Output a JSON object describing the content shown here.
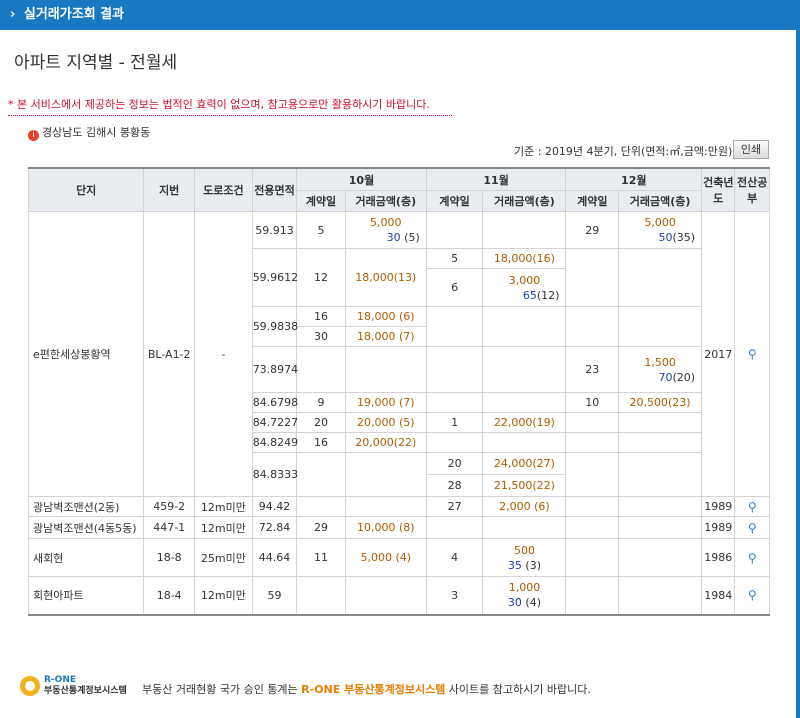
{
  "header": {
    "arrow": "›",
    "title": "실거래가조회 결과"
  },
  "page_title": "아파트 지역별 - 전월세",
  "notice": "* 본 서비스에서 제공하는 정보는 법적인 효력이 없으며, 참고용으로만 활용하시기 바랍니다.",
  "region": {
    "icon": "i",
    "label": "경상남도 김해시 봉황동"
  },
  "basis": "기준 : 2019년 4분기, 단위(면적:㎡,금액:만원)",
  "print_label": "인쇄",
  "columns": {
    "complex": "단지",
    "lot": "지번",
    "road": "도로조건",
    "area": "전용면적",
    "m10": "10월",
    "m11": "11월",
    "m12": "12월",
    "contract_day": "계약일",
    "amount": "거래금액(층)",
    "built": "건축년도",
    "cadastre": "전산공부"
  },
  "complexes": [
    {
      "name": "e편한세상봉황역",
      "lot": "BL-A1-2",
      "road": "-",
      "built": "2017",
      "rows": [
        {
          "area": "59.913",
          "m10_day": "5",
          "m10_amt": "5,000",
          "m10_rent": "30",
          "m10_floor": "(5)",
          "m12_day": "29",
          "m12_amt": "5,000",
          "m12_rent": "50",
          "m12_floor": "(35)"
        },
        {
          "area": "59.9612",
          "m10_day": "12",
          "m10_amt": "18,000(13)",
          "m11a_day": "5",
          "m11a_amt": "18,000(16)",
          "m11b_day": "6",
          "m11b_amt": "3,000",
          "m11b_rent": "65",
          "m11b_floor": "(12)"
        },
        {
          "area": "59.9838",
          "m10a_day": "16",
          "m10a_amt": "18,000 (6)",
          "m10b_day": "30",
          "m10b_amt": "18,000 (7)"
        },
        {
          "area": "73.8974",
          "m12_day": "23",
          "m12_amt": "1,500",
          "m12_rent": "70",
          "m12_floor": "(20)"
        },
        {
          "area": "84.6798",
          "m10_day": "9",
          "m10_amt": "19,000 (7)",
          "m12_day": "10",
          "m12_amt": "20,500(23)"
        },
        {
          "area": "84.7227",
          "m10_day": "20",
          "m10_amt": "20,000 (5)",
          "m11_day": "1",
          "m11_amt": "22,000(19)"
        },
        {
          "area": "84.8249",
          "m10_day": "16",
          "m10_amt": "20,000(22)"
        },
        {
          "area": "84.8333",
          "m11a_day": "20",
          "m11a_amt": "24,000(27)",
          "m11b_day": "28",
          "m11b_amt": "21,500(22)"
        }
      ]
    },
    {
      "name": "광남벽조맨션(2동)",
      "lot": "459-2",
      "road": "12m미만",
      "area": "94.42",
      "built": "1989",
      "m11_day": "27",
      "m11_amt": "2,000 (6)"
    },
    {
      "name": "광남벽조맨션(4동5동)",
      "lot": "447-1",
      "road": "12m미만",
      "area": "72.84",
      "built": "1989",
      "m10_day": "29",
      "m10_amt": "10,000 (8)"
    },
    {
      "name": "새회현",
      "lot": "18-8",
      "road": "25m미만",
      "area": "44.64",
      "built": "1986",
      "m10_day": "11",
      "m10_amt": "5,000 (4)",
      "m11_day": "4",
      "m11_amt": "500",
      "m11_rent": "35",
      "m11_floor": "(3)"
    },
    {
      "name": "회현아파트",
      "lot": "18-4",
      "road": "12m미만",
      "area": "59",
      "built": "1984",
      "m11_day": "3",
      "m11_amt": "1,000",
      "m11_rent": "30",
      "m11_floor": "(4)"
    }
  ],
  "footer": {
    "logo_line1": "R-ONE",
    "logo_line2": "부동산통계정보시스템",
    "text_before": "부동산 거래현황 국가 승인 통계는 ",
    "text_highlight": "R-ONE 부동산통계정보시스템",
    "text_after": " 사이트를 참고하시기 바랍니다."
  },
  "icons": {
    "cadastre": "magnifier-icon",
    "region": "info-icon"
  }
}
